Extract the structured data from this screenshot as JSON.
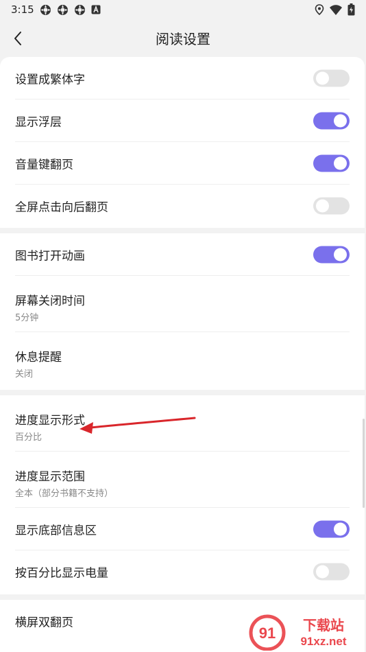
{
  "status_bar": {
    "time": "3:15",
    "left_icons": [
      "app-notification-icon",
      "app-notification-icon",
      "app-notification-icon",
      "a-badge-icon"
    ],
    "right_icons": [
      "location-icon",
      "wifi-icon",
      "battery-icon"
    ]
  },
  "header": {
    "title": "阅读设置",
    "back_icon": "chevron-left-icon"
  },
  "sections": [
    {
      "items": [
        {
          "label": "设置成繁体字",
          "toggle": false
        },
        {
          "label": "显示浮层",
          "toggle": true
        },
        {
          "label": "音量键翻页",
          "toggle": true
        },
        {
          "label": "全屏点击向后翻页",
          "toggle": false
        }
      ]
    },
    {
      "items": [
        {
          "label": "图书打开动画",
          "toggle": true
        },
        {
          "label": "屏幕关闭时间",
          "value": "5分钟"
        },
        {
          "label": "休息提醒",
          "value": "关闭"
        }
      ]
    },
    {
      "items": [
        {
          "label": "进度显示形式",
          "value": "百分比"
        },
        {
          "label": "进度显示范围",
          "value": "全本（部分书籍不支持）"
        },
        {
          "label": "显示底部信息区",
          "toggle": true
        },
        {
          "label": "按百分比显示电量",
          "toggle": false
        }
      ]
    },
    {
      "items": [
        {
          "label": "横屏双翻页"
        }
      ]
    }
  ],
  "colors": {
    "toggle_on": "#7a70ec",
    "toggle_off": "#e3e3e3",
    "annotation_arrow": "#d9262b",
    "watermark_red": "#e8343a"
  },
  "watermark": {
    "logo_text": "91",
    "brand": "下载站",
    "url": "91xz.net"
  }
}
